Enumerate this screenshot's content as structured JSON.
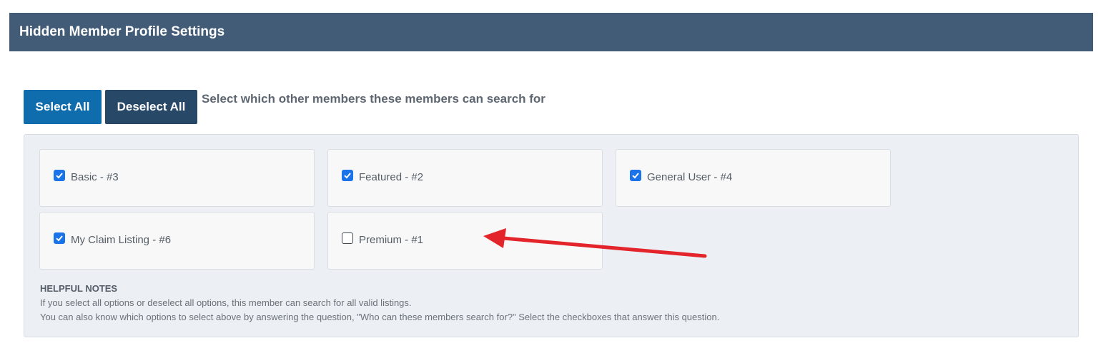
{
  "header": {
    "title": "Hidden Member Profile Settings"
  },
  "toolbar": {
    "select_all_label": "Select All",
    "deselect_all_label": "Deselect All",
    "prompt": "Select which other members these members can search for"
  },
  "options": [
    {
      "label": "Basic - #3",
      "checked": true
    },
    {
      "label": "Featured - #2",
      "checked": true
    },
    {
      "label": "General User - #4",
      "checked": true
    },
    {
      "label": "My Claim Listing - #6",
      "checked": true
    },
    {
      "label": "Premium - #1",
      "checked": false
    }
  ],
  "notes": {
    "title": "HELPFUL NOTES",
    "line1": "If you select all options or deselect all options, this member can search for all valid listings.",
    "line2": "You can also know which options to select above by answering the question, \"Who can these members search for?\" Select the checkboxes that answer this question."
  },
  "colors": {
    "header_bg": "#425c78",
    "select_all_bg": "#0f6cad",
    "deselect_all_bg": "#274867",
    "checkbox_checked": "#1a73e8",
    "annotation_arrow": "#e3242b"
  }
}
